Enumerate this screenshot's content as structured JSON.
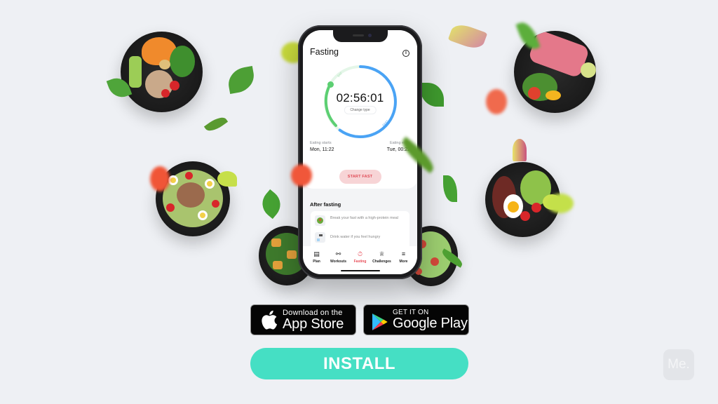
{
  "app": {
    "screen_title": "Fasting",
    "timer": "02:56:01",
    "change_type_label": "Change type",
    "ring_labels": {
      "eat": "EAT",
      "fast": "FAST"
    },
    "eating_starts_label": "Eating starts",
    "eating_starts_value": "Mon, 11:22",
    "eating_ends_label": "Eating ends",
    "eating_ends_value": "Tue, 00:22",
    "start_button": "START FAST",
    "after_fasting": {
      "title": "After fasting",
      "tips": [
        {
          "icon": "salad-icon",
          "text": "Break your fast with a high-protein meal"
        },
        {
          "icon": "water-tap-icon",
          "text": "Drink water if you feel hungry"
        }
      ]
    },
    "tabbar": [
      {
        "label": "Plan",
        "icon": "plan-icon",
        "glyph": "▤",
        "active": false
      },
      {
        "label": "Workouts",
        "icon": "dumbbell-icon",
        "glyph": "⚯",
        "active": false
      },
      {
        "label": "Fasting",
        "icon": "stopwatch-icon",
        "glyph": "⏱",
        "active": true
      },
      {
        "label": "Challenges",
        "icon": "trophy-icon",
        "glyph": "♕",
        "active": false
      },
      {
        "label": "More",
        "icon": "menu-icon",
        "glyph": "≡",
        "active": false
      }
    ],
    "colors": {
      "eat": "#5ccf72",
      "fast": "#4aa3f5",
      "accent": "#e84c57"
    }
  },
  "store_badges": {
    "apple": {
      "small": "Download on the",
      "big": "App Store"
    },
    "google": {
      "small": "GET IT ON",
      "big": "Google Play"
    }
  },
  "install_button": "INSTALL",
  "brand_logo": "Me.",
  "colors": {
    "install": "#45dfc4",
    "background": "#eef0f4"
  }
}
